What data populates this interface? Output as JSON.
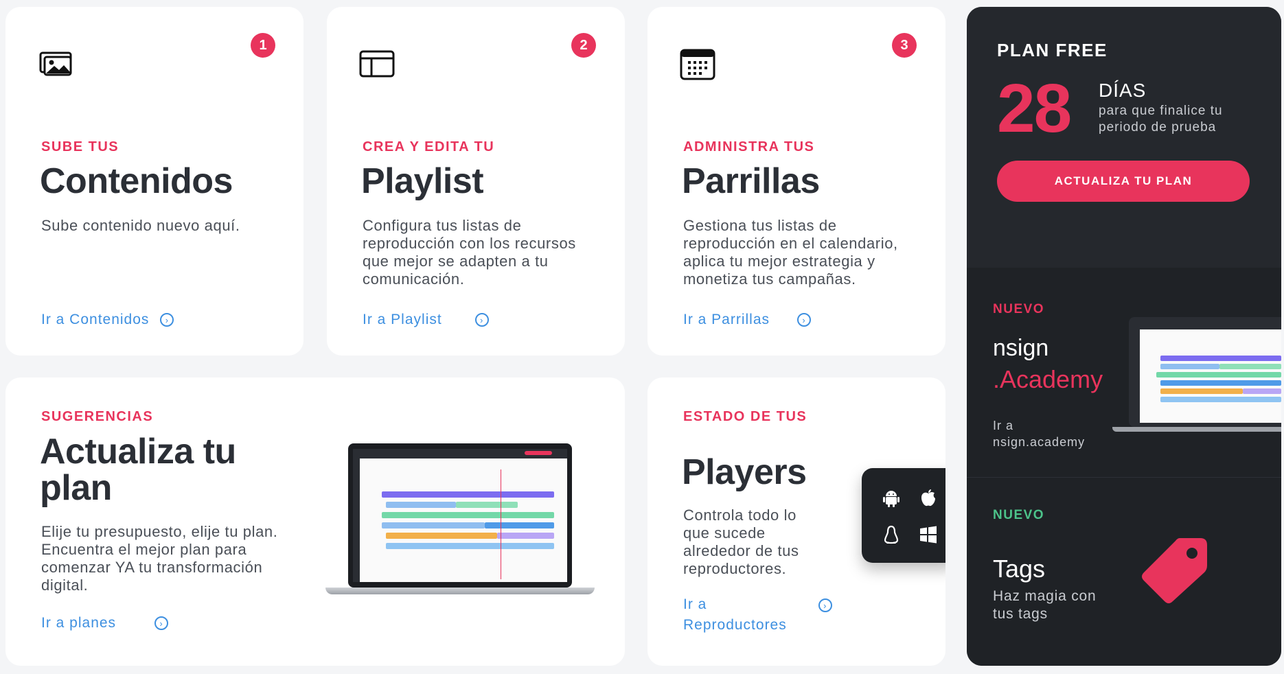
{
  "cards": [
    {
      "badge": "1",
      "icon": "image-gallery-icon",
      "eyebrow": "SUBE TUS",
      "title": "Contenidos",
      "description": "Sube contenido nuevo aquí.",
      "link": "Ir a Contenidos"
    },
    {
      "badge": "2",
      "icon": "layout-icon",
      "eyebrow": "CREA Y EDITA TU",
      "title": "Playlist",
      "description": "Configura tus listas de reproducción con los recursos que mejor se adapten a tu comunicación.",
      "link": "Ir a Playlist"
    },
    {
      "badge": "3",
      "icon": "calendar-icon",
      "eyebrow": "ADMINISTRA TUS",
      "title": "Parrillas",
      "description": "Gestiona tus listas de reproducción en el calendario, aplica tu mejor estrategia y monetiza tus campañas.",
      "link": "Ir a Parrillas"
    }
  ],
  "suggestions": {
    "eyebrow": "SUGERENCIAS",
    "title_line1": "Actualiza tu",
    "title_line2": "plan",
    "description": "Elije tu presupuesto, elije tu plan. Encuentra el mejor plan para comenzar YA tu transformación digital.",
    "link": "Ir a planes"
  },
  "players": {
    "eyebrow": "ESTADO DE TUS",
    "title": "Players",
    "description": "Controla todo lo que sucede alrededor de tus reproductores.",
    "link_line1": "Ir a",
    "link_line2": "Reproductores",
    "os_icons": [
      "android-icon",
      "apple-icon",
      "linux-icon",
      "windows-icon"
    ]
  },
  "plan": {
    "label": "PLAN FREE",
    "days_number": "28",
    "days_label": "DÍAS",
    "days_desc": "para que finalice tu periodo de prueba",
    "button": "ACTUALIZA TU PLAN"
  },
  "academy": {
    "badge": "NUEVO",
    "brand_top": "nsign",
    "brand_bottom": ".Academy",
    "link_line1": "Ir a",
    "link_line2": "nsign.academy"
  },
  "tags": {
    "badge": "NUEVO",
    "title": "Tags",
    "description": "Haz magia con tus tags"
  },
  "colors": {
    "accent": "#e8345c",
    "link": "#3d8fe0",
    "new_green": "#4cc38a",
    "dark_panel": "#1f2226"
  }
}
